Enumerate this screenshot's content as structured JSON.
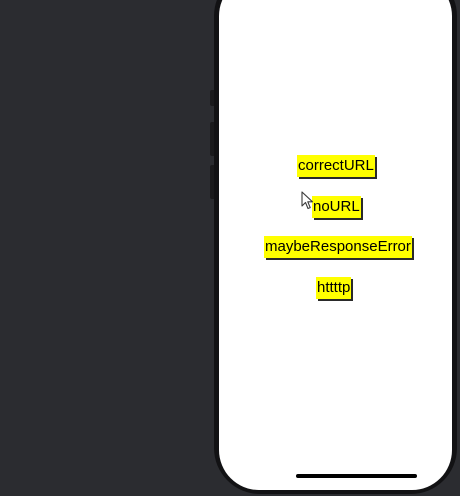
{
  "colors": {
    "desktop_background": "#2b2c30",
    "device_frame": "#121214",
    "screen_background": "#ffffff",
    "button_background": "#ffff00",
    "button_text": "#000000"
  },
  "buttons": {
    "correct_url": "correctURL",
    "no_url": "noURL",
    "maybe_response_error": "maybeResponseError",
    "httttp": "httttp"
  },
  "icons": {
    "pointer": "mouse-pointer-icon"
  }
}
